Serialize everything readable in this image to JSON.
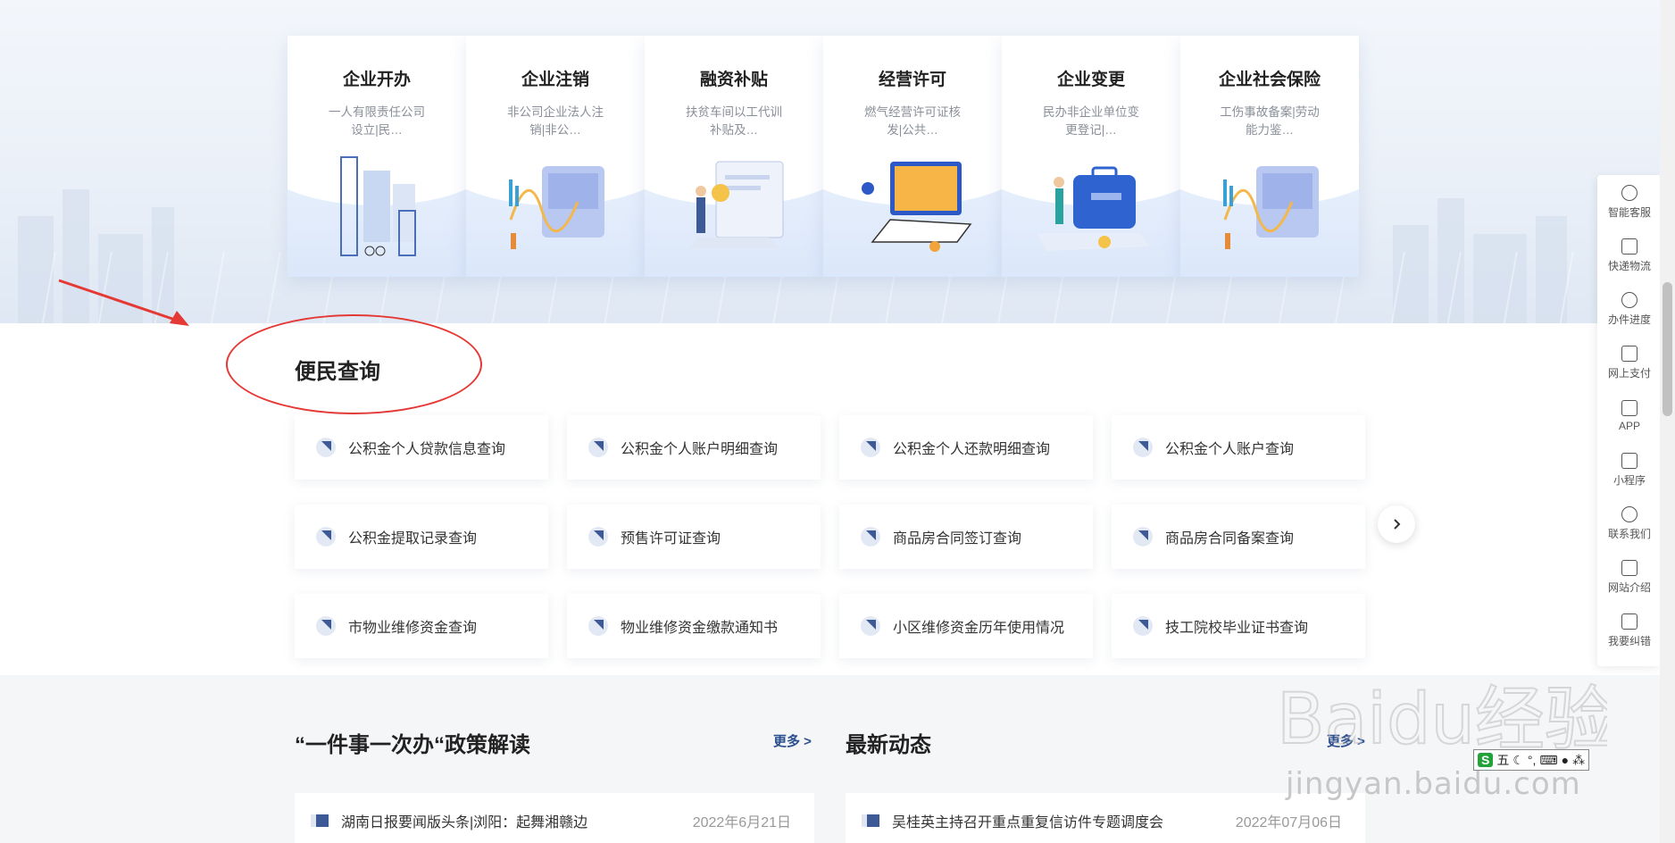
{
  "service_cards": [
    {
      "title": "企业开办",
      "desc": "一人有限责任公司设立|民…"
    },
    {
      "title": "企业注销",
      "desc": "非公司企业法人注销|非公…"
    },
    {
      "title": "融资补贴",
      "desc": "扶贫车间以工代训补贴及…"
    },
    {
      "title": "经营许可",
      "desc": "燃气经营许可证核发|公共…"
    },
    {
      "title": "企业变更",
      "desc": "民办非企业单位变更登记|…"
    },
    {
      "title": "企业社会保险",
      "desc": "工伤事故备案|劳动能力鉴…"
    }
  ],
  "convenience": {
    "title": "便民查询",
    "items": [
      "公积金个人贷款信息查询",
      "公积金个人账户明细查询",
      "公积金个人还款明细查询",
      "公积金个人账户查询",
      "公积金提取记录查询",
      "预售许可证查询",
      "商品房合同签订查询",
      "商品房合同备案查询",
      "市物业维修资金查询",
      "物业维修资金缴款通知书",
      "小区维修资金历年使用情况",
      "技工院校毕业证书查询"
    ],
    "next_icon": "chevron-right-icon"
  },
  "policy": {
    "title": "“一件事一次办“政策解读",
    "more": "更多 >",
    "news": {
      "text": "湖南日报要闻版头条|浏阳：起舞湘赣边",
      "date": "2022年6月21日"
    }
  },
  "latest": {
    "title": "最新动态",
    "more": "更多 >",
    "news": {
      "text": "吴桂英主持召开重点重复信访件专题调度会",
      "date": "2022年07月06日"
    }
  },
  "sidebar": [
    {
      "label": "智能客服",
      "icon": "headset-icon"
    },
    {
      "label": "快递物流",
      "icon": "truck-icon"
    },
    {
      "label": "办件进度",
      "icon": "clock-icon"
    },
    {
      "label": "网上支付",
      "icon": "payment-icon"
    },
    {
      "label": "APP",
      "icon": "app-icon"
    },
    {
      "label": "小程序",
      "icon": "miniprogram-icon"
    },
    {
      "label": "联系我们",
      "icon": "headset-icon"
    },
    {
      "label": "网站介绍",
      "icon": "document-icon"
    },
    {
      "label": "我要纠错",
      "icon": "clipboard-icon"
    }
  ],
  "watermark": {
    "brand": "Baidu经验",
    "url": "jingyan.baidu.com"
  },
  "ime_bar": {
    "mode": "S",
    "text": "五"
  },
  "colors": {
    "accent": "#3d5a96",
    "annotation": "#e53935"
  }
}
